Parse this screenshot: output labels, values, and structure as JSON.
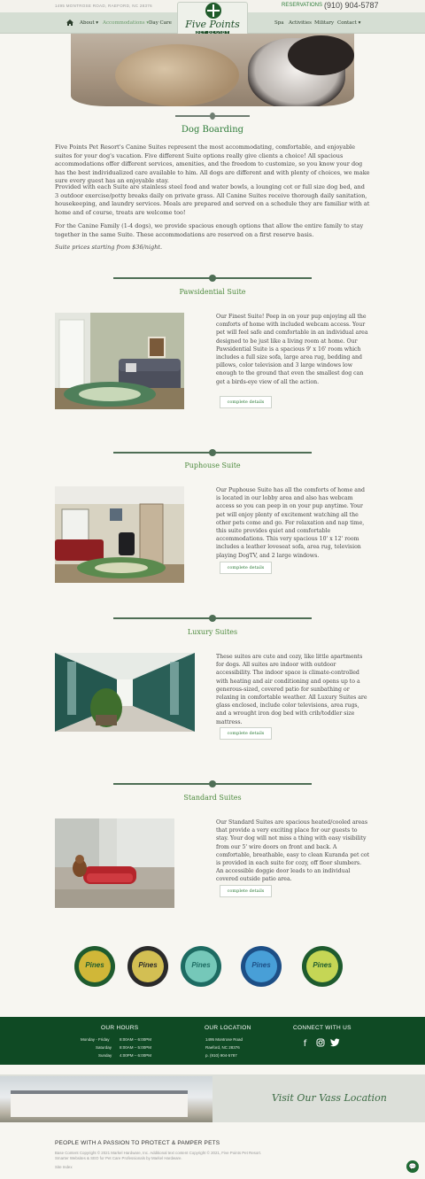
{
  "topbar": {
    "address": "1495 MONTROSE ROAD, RAEFORD, NC 28376",
    "reservations": "RESERVATIONS",
    "phone": "(910) 904-5787"
  },
  "nav": {
    "home_icon": "home-icon",
    "about": "About ▾",
    "accommodations": "Accommodations ▾",
    "daycare": "Day Care",
    "spa": "Spa",
    "activities": "Activities",
    "military": "Military",
    "contact": "Contact ▾"
  },
  "logo": {
    "name": "Five Points",
    "sub": "PET RESORT"
  },
  "page": {
    "title": "Dog Boarding",
    "p1": "Five Points Pet Resort's Canine Suites represent the most accommodating, comfortable, and enjoyable suites for your dog's vacation. Five different Suite options really give clients a choice! All spacious accommodations offer different services, amenities, and the freedom to customize, so you know your dog has the best individualized care available to him. All dogs are different and with plenty of choices, we make sure every guest has an enjoyable stay.",
    "p2": "Provided with each Suite are stainless steel food and water bowls, a lounging cot or full size dog bed, and 3 outdoor exercise/potty breaks daily on private grass. All Canine Suites receive thorough daily sanitation, housekeeping, and laundry services. Meals are prepared and served on a schedule they are familiar with at home and of course, treats are welcome too!",
    "p3": "For the Canine Family (1-4 dogs), we provide spacious enough options that allow the entire family to stay together in the same Suite. These accommodations are reserved on a first reserve basis.",
    "p4": "Suite prices starting from $36/night."
  },
  "suites": [
    {
      "title": "Pawsidential Suite",
      "description": "Our Finest Suite! Peep in on your pup enjoying all the comforts of home with included webcam access. Your pet will feel safe and comfortable in an individual area designed to be just like a living room at home. Our Pawsidential Suite is a spacious 9' x 16' room which includes a full size sofa, large area rug, bedding and pillows, color television and 3 large windows low enough to the ground that even the smallest dog can get a birds-eye view of all the action.",
      "button": "complete details"
    },
    {
      "title": "Puphouse Suite",
      "description": "Our Puphouse Suite has all the comforts of home and is located in our lobby area and also has webcam access so you can peep in on your pup anytime. Your pet will enjoy plenty of excitement watching all the other pets come and go. For relaxation and nap time, this suite provides quiet and comfortable accommodations. This very spacious 10' x 12' room includes a leather loveseat sofa, area rug, television playing DogTV, and 2 large windows.",
      "button": "complete details"
    },
    {
      "title": "Luxury Suites",
      "description": "These suites are cute and cozy, like little apartments for dogs. All suites are indoor with outdoor accessibility. The indoor space is climate-controlled with heating and air conditioning and opens up to a generous-sized, covered patio for sunbathing or relaxing in comfortable weather. All Luxury Suites are glass enclosed, include color televisions, area rugs, and a wrought iron dog bed with crib/toddler size mattress.",
      "button": "complete details"
    },
    {
      "title": "Standard Suites",
      "description": "Our Standard Suites are spacious heated/cooled areas that provide a very exciting place for our guests to stay. Your dog will not miss a thing with easy visibility from our 5' wire doors on front and back. A comfortable, breathable, easy to clean Kuranda pet cot is provided in each suite for cozy, off floor slumbers. An accessible doggie door leads to an individual covered outside patio area.",
      "button": "complete details"
    }
  ],
  "badges": [
    {
      "text": "Pines",
      "colors": [
        "#1e5b2e",
        "#e3c13a"
      ]
    },
    {
      "text": "Pines",
      "colors": [
        "#2a2a2a",
        "#e6cf58"
      ]
    },
    {
      "text": "Pines",
      "colors": [
        "#1d6b62",
        "#7fd3c3"
      ]
    },
    {
      "text": "Pines",
      "colors": [
        "#1d4f86",
        "#4ea7e0"
      ]
    },
    {
      "text": "Pines",
      "colors": [
        "#1e5b2e",
        "#d7e35a"
      ]
    }
  ],
  "footer": {
    "hours_title": "OUR HOURS",
    "hours": [
      {
        "day": "Monday - Friday",
        "time": "8:00AM – 6:00PM"
      },
      {
        "day": "Saturday",
        "time": "8:00AM – 5:00PM"
      },
      {
        "day": "Sunday",
        "time": "4:00PM – 6:00PM"
      }
    ],
    "location_title": "OUR LOCATION",
    "location_lines": [
      "1495 Montrose Road",
      "Raeford, NC 28376"
    ],
    "location_phone": "p. (910) 904-5787",
    "connect_title": "CONNECT WITH US",
    "social": [
      "facebook-icon",
      "instagram-icon",
      "twitter-icon"
    ]
  },
  "vass": {
    "label": "Visit Our Vass Location"
  },
  "bottom": {
    "tagline": "PEOPLE WITH A PASSION TO PROTECT & PAMPER PETS",
    "line1": "Base Content Copyright © 2021 Markel Hardware, Inc. Additional text content Copyright © 2021, Five Points Pet Resort.",
    "line2": "Smarter Websites & SEO for Pet Care Professionals by Markel Hardware.",
    "line3": "Site Index"
  },
  "colors": {
    "brand_green": "#2f7d3a",
    "footer_green": "#0f4a24",
    "nav_bg": "#d5ded3"
  }
}
